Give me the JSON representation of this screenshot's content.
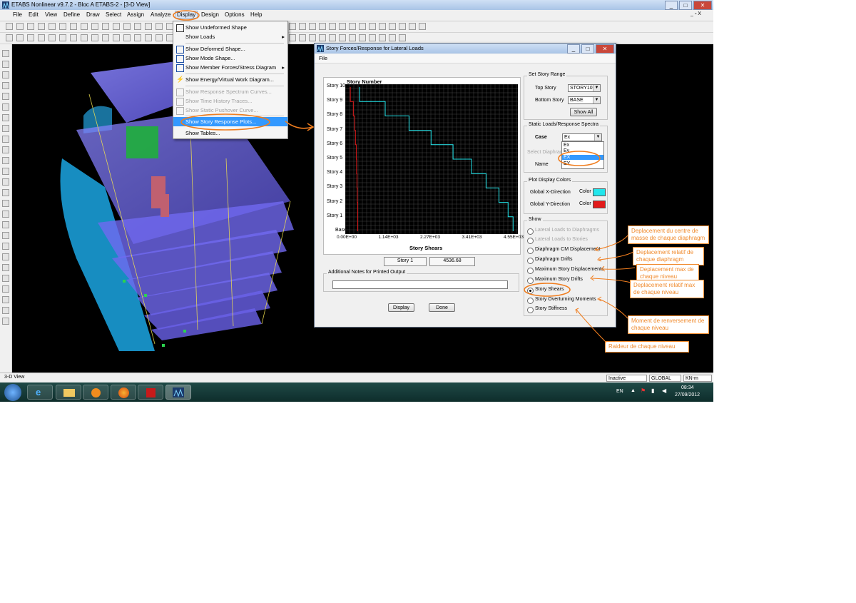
{
  "app": {
    "title": "ETABS Nonlinear v9.7.2 - Bloc A ETABS-2 - [3-D View]",
    "window_controls": {
      "minimize": "_",
      "maximize": "□",
      "close": "✕"
    },
    "mdi_controls": "_ ▫ X"
  },
  "menu": {
    "items": [
      "File",
      "Edit",
      "View",
      "Define",
      "Draw",
      "Select",
      "Assign",
      "Analyze",
      "Display",
      "Design",
      "Options",
      "Help"
    ],
    "active": "Display"
  },
  "display_menu": {
    "items": [
      {
        "label": "Show Undeformed Shape",
        "enabled": true
      },
      {
        "label": "Show Loads",
        "enabled": true,
        "submenu": true
      },
      {
        "label": "Show Deformed Shape...",
        "enabled": true
      },
      {
        "label": "Show Mode Shape...",
        "enabled": true
      },
      {
        "label": "Show Member Forces/Stress Diagram",
        "enabled": true,
        "submenu": true
      },
      {
        "label": "Show Energy/Virtual Work Diagram...",
        "enabled": true
      },
      {
        "label": "Show Response Spectrum Curves...",
        "enabled": false
      },
      {
        "label": "Show Time History Traces...",
        "enabled": false
      },
      {
        "label": "Show Static Pushover Curve...",
        "enabled": false
      },
      {
        "label": "Show Story Response Plots...",
        "enabled": true,
        "highlighted": true
      },
      {
        "label": "Show Tables...",
        "enabled": true
      }
    ]
  },
  "statusbar": {
    "view_label": "3-D View",
    "mode": "Inactive",
    "coord_system": "GLOBAL",
    "units": "KN-m"
  },
  "taskbar": {
    "lang": "EN",
    "time": "08:34",
    "date": "27/09/2012"
  },
  "dialog": {
    "title": "Story Forces/Response for Lateral Loads",
    "menu": "File",
    "plot": {
      "y_title": "Story Number",
      "x_title": "Story Shears",
      "stories": [
        "Story 10",
        "Story 9",
        "Story 8",
        "Story 7",
        "Story 6",
        "Story 5",
        "Story 4",
        "Story 3",
        "Story 2",
        "Story 1",
        "Base"
      ],
      "x_ticks": [
        "0.00E+00",
        "1.14E+03",
        "2.27E+03",
        "3.41E+03",
        "4.55E+03"
      ],
      "selected_story": "Story 1",
      "selected_value": "4536.68",
      "unit_note": "KN"
    },
    "story_range": {
      "caption": "Set Story Range",
      "top_label": "Top Story",
      "top_value": "STORY10",
      "bottom_label": "Bottom Story",
      "bottom_value": "BASE",
      "show_all": "Show All"
    },
    "static_loads": {
      "caption": "Static Loads/Response Spectra",
      "case_label": "Case",
      "case_value": "Ex",
      "options": [
        "Ex",
        "Ey",
        "EX",
        "EY"
      ],
      "selected_option": "EX"
    },
    "select_group": {
      "caption": "Select Diaphragm",
      "name_label": "Name"
    },
    "colors": {
      "caption": "Plot Display Colors",
      "x_label": "Global X-Direction",
      "y_label": "Global Y-Direction",
      "color_label": "Color",
      "x_color": "#22e6ec",
      "y_color": "#e21a1a"
    },
    "show": {
      "caption": "Show",
      "options": [
        {
          "label": "Lateral Loads to Diaphragms",
          "enabled": false,
          "checked": false
        },
        {
          "label": "Lateral Loads to Stories",
          "enabled": false,
          "checked": false
        },
        {
          "label": "Diaphragm CM Displacement",
          "enabled": true,
          "checked": false
        },
        {
          "label": "Diaphragm Drifts",
          "enabled": true,
          "checked": false
        },
        {
          "label": "Maximum Story Displacements",
          "enabled": true,
          "checked": false
        },
        {
          "label": "Maximum Story Drifts",
          "enabled": true,
          "checked": false
        },
        {
          "label": "Story Shears",
          "enabled": true,
          "checked": true
        },
        {
          "label": "Story Overturning Moments",
          "enabled": true,
          "checked": false
        },
        {
          "label": "Story Stiffness",
          "enabled": true,
          "checked": false
        }
      ]
    },
    "notes_caption": "Additional Notes for Printed Output",
    "display_button": "Display",
    "done_button": "Done"
  },
  "chart_data": {
    "type": "line",
    "title": "",
    "xlabel": "Story Shears",
    "ylabel": "Story Number",
    "categories": [
      "Base",
      "Story 1",
      "Story 2",
      "Story 3",
      "Story 4",
      "Story 5",
      "Story 6",
      "Story 7",
      "Story 8",
      "Story 9",
      "Story 10"
    ],
    "xlim": [
      0,
      4550
    ],
    "series": [
      {
        "name": "Global X-Direction",
        "color": "#22e6ec",
        "values": [
          4536.68,
          4536.68,
          4400,
          4150,
          3800,
          3400,
          2900,
          2300,
          1700,
          1050,
          350
        ]
      },
      {
        "name": "Global Y-Direction",
        "color": "#e21a1a",
        "values": [
          300,
          300,
          300,
          290,
          280,
          270,
          260,
          240,
          220,
          180,
          100
        ]
      }
    ]
  },
  "annotations": [
    "Deplacement du centre de masse de chaque diaphragm",
    "Deplacement relatif de chaque diaphragm",
    "Deplacement max de chaque niveau",
    "Deplacement relatif max de chaque niveau",
    "Moment de renversement de chaque niveau",
    "Raideur de chaque niveau"
  ]
}
